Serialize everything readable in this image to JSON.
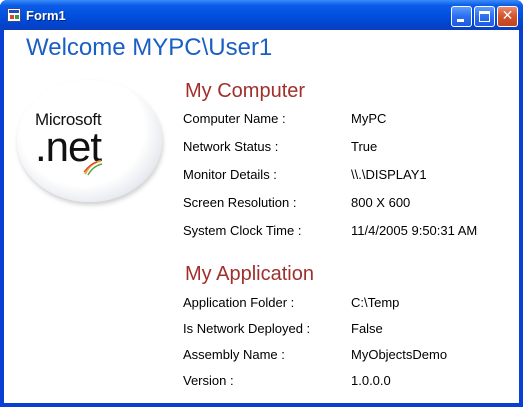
{
  "window": {
    "title": "Form1"
  },
  "welcome": "Welcome MYPC\\User1",
  "logo": {
    "brand": "Microsoft",
    "product": ".net"
  },
  "my_computer": {
    "heading": "My Computer",
    "rows": [
      {
        "label": "Computer Name :",
        "value": "MyPC"
      },
      {
        "label": "Network Status :",
        "value": "True"
      },
      {
        "label": "Monitor Details :",
        "value": "\\\\.\\DISPLAY1"
      },
      {
        "label": "Screen Resolution :",
        "value": "800 X 600"
      },
      {
        "label": "System Clock Time :",
        "value": "11/4/2005 9:50:31 AM"
      }
    ]
  },
  "my_application": {
    "heading": "My Application",
    "rows": [
      {
        "label": "Application Folder :",
        "value": "C:\\Temp"
      },
      {
        "label": "Is Network Deployed :",
        "value": "False"
      },
      {
        "label": "Assembly Name :",
        "value": "MyObjectsDemo"
      },
      {
        "label": "Version :",
        "value": "1.0.0.0"
      }
    ]
  },
  "colors": {
    "title_bar": "#0352e2",
    "welcome_text": "#1a5fc4",
    "section_heading": "#a0302c"
  },
  "icons": {
    "app": "form-window-icon",
    "minimize": "minimize-icon",
    "maximize": "maximize-icon",
    "close": "close-icon"
  }
}
